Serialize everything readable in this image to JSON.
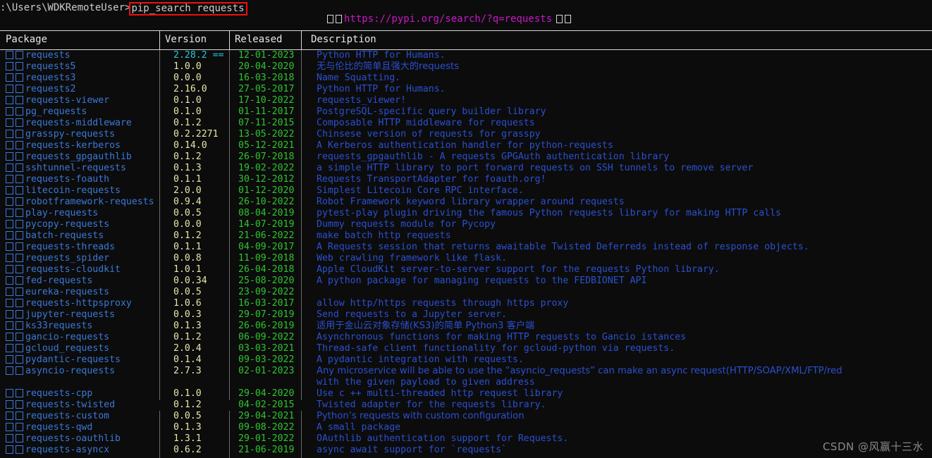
{
  "terminal": {
    "prompt_path": ":\\Users\\WDKRemoteUser>",
    "command": "pip_search requests",
    "highlight_color": "#ee1111",
    "url_text": "https://pypi.org/search/?q=requests",
    "url_color": "#c818c8",
    "tofu_glyph_name": "missing-glyph-box"
  },
  "table": {
    "columns": [
      "Package",
      "Version",
      "Released",
      "Description"
    ],
    "colors": {
      "package": "#3b78d8",
      "version": "#e9e6a8",
      "version_installed": "#24c8d8",
      "released": "#2ec52e",
      "description": "#2b50d0",
      "header": "#e8e8e8",
      "background": "#0c0c0c"
    },
    "rows": [
      {
        "package": "requests",
        "version": "2.28.2 ==",
        "installed": true,
        "released": "12-01-2023",
        "description": "Python HTTP for Humans."
      },
      {
        "package": "requests5",
        "version": "1.0.0",
        "installed": false,
        "released": "20-04-2020",
        "description": "无与伦比的简单且强大的requests"
      },
      {
        "package": "requests3",
        "version": "0.0.0",
        "installed": false,
        "released": "16-03-2018",
        "description": "Name Squatting."
      },
      {
        "package": "requests2",
        "version": "2.16.0",
        "installed": false,
        "released": "27-05-2017",
        "description": "Python HTTP for Humans."
      },
      {
        "package": "requests-viewer",
        "version": "0.1.0",
        "installed": false,
        "released": "17-10-2022",
        "description": "requests_viewer!"
      },
      {
        "package": "pg_requests",
        "version": "0.1.0",
        "installed": false,
        "released": "01-11-2017",
        "description": "PostgreSQL-specific query builder library"
      },
      {
        "package": "requests-middleware",
        "version": "0.1.2",
        "installed": false,
        "released": "07-11-2015",
        "description": "Composable HTTP middleware for requests"
      },
      {
        "package": "grasspy-requests",
        "version": "0.2.2271",
        "installed": false,
        "released": "13-05-2022",
        "description": "Chinsese version of requests for grasspy"
      },
      {
        "package": "requests-kerberos",
        "version": "0.14.0",
        "installed": false,
        "released": "05-12-2021",
        "description": "A Kerberos authentication handler for python-requests"
      },
      {
        "package": "requests_gpgauthlib",
        "version": "0.1.2",
        "installed": false,
        "released": "26-07-2018",
        "description": "requests_gpgauthlib - A requests GPGAuth authentication library"
      },
      {
        "package": "sshtunnel-requests",
        "version": "0.1.3",
        "installed": false,
        "released": "19-02-2022",
        "description": "a simple HTTP library to port forward requests on SSH tunnels to remove server"
      },
      {
        "package": "requests-foauth",
        "version": "0.1.1",
        "installed": false,
        "released": "30-12-2012",
        "description": "Requests TransportAdapter for foauth.org!"
      },
      {
        "package": "litecoin-requests",
        "version": "2.0.0",
        "installed": false,
        "released": "01-12-2020",
        "description": "Simplest Litecoin Core RPC interface."
      },
      {
        "package": "robotframework-requests",
        "version": "0.9.4",
        "installed": false,
        "released": "26-10-2022",
        "description": "Robot Framework keyword library wrapper around requests"
      },
      {
        "package": "play-requests",
        "version": "0.0.5",
        "installed": false,
        "released": "08-04-2019",
        "description": "pytest-play plugin driving the famous Python requests library for making HTTP calls"
      },
      {
        "package": "pycopy-requests",
        "version": "0.0.0",
        "installed": false,
        "released": "14-07-2019",
        "description": "Dummy requests module for Pycopy"
      },
      {
        "package": "batch-requests",
        "version": "0.1.2",
        "installed": false,
        "released": "21-06-2022",
        "description": "make batch http requests"
      },
      {
        "package": "requests-threads",
        "version": "0.1.1",
        "installed": false,
        "released": "04-09-2017",
        "description": "A Requests session that returns awaitable Twisted Deferreds instead of response objects."
      },
      {
        "package": "requests_spider",
        "version": "0.0.8",
        "installed": false,
        "released": "11-09-2018",
        "description": "Web crawling framework like flask."
      },
      {
        "package": "requests-cloudkit",
        "version": "1.0.1",
        "installed": false,
        "released": "26-04-2018",
        "description": "Apple CloudKit server-to-server support for the requests Python library."
      },
      {
        "package": "fed-requests",
        "version": "0.0.34",
        "installed": false,
        "released": "25-08-2020",
        "description": "A python package for managing requests to the FEDBIONET API"
      },
      {
        "package": "eureka-requests",
        "version": "0.0.5",
        "installed": false,
        "released": "23-09-2022",
        "description": ""
      },
      {
        "package": "requests-httpsproxy",
        "version": "1.0.6",
        "installed": false,
        "released": "16-03-2017",
        "description": "allow http/https requests through https proxy"
      },
      {
        "package": "jupyter-requests",
        "version": "0.0.3",
        "installed": false,
        "released": "29-07-2019",
        "description": "Send requests to a Jupyter server."
      },
      {
        "package": "ks33requests",
        "version": "0.1.3",
        "installed": false,
        "released": "26-06-2019",
        "description": "适用于金山云对象存储(KS3)的简单 Python3 客户端"
      },
      {
        "package": "gancio-requests",
        "version": "0.1.2",
        "installed": false,
        "released": "06-09-2022",
        "description": "Asynchronous functions for making HTTP requests to Gancio istances"
      },
      {
        "package": "gcloud_requests",
        "version": "2.0.4",
        "installed": false,
        "released": "03-03-2021",
        "description": "Thread-safe client functionality for gcloud-python via requests."
      },
      {
        "package": "pydantic-requests",
        "version": "0.1.4",
        "installed": false,
        "released": "09-03-2022",
        "description": "A pydantic integration with requests."
      },
      {
        "package": "asyncio-requests",
        "version": "2.7.3",
        "installed": false,
        "released": "02-01-2023",
        "description": "Any microservice will be able to use the “asyncio_requests” can make an async request(HTTP/SOAP/XML/FTP/red"
      },
      {
        "package": "",
        "version": "",
        "installed": false,
        "released": "",
        "description": "with the given payload to given address"
      },
      {
        "package": "requests-cpp",
        "version": "0.1.0",
        "installed": false,
        "released": "29-04-2020",
        "description": "Use c ++ multi-threaded http request library"
      },
      {
        "package": "requests-twisted",
        "version": "0.1.2",
        "installed": false,
        "released": "04-02-2015",
        "description": "Twisted adapter for the requests library."
      },
      {
        "package": "requests-custom",
        "version": "0.0.5",
        "installed": false,
        "released": "29-04-2021",
        "description": "Python’s requests with custom configuration"
      },
      {
        "package": "requests-qwd",
        "version": "0.1.3",
        "installed": false,
        "released": "09-08-2022",
        "description": "A small package"
      },
      {
        "package": "requests-oauthlib",
        "version": "1.3.1",
        "installed": false,
        "released": "29-01-2022",
        "description": "OAuthlib authentication support for Requests."
      },
      {
        "package": "requests-asyncx",
        "version": "0.6.2",
        "installed": false,
        "released": "21-06-2019",
        "description": "async await support for `requests`"
      }
    ]
  },
  "watermark": {
    "text": "CSDN @风赢十三水"
  }
}
